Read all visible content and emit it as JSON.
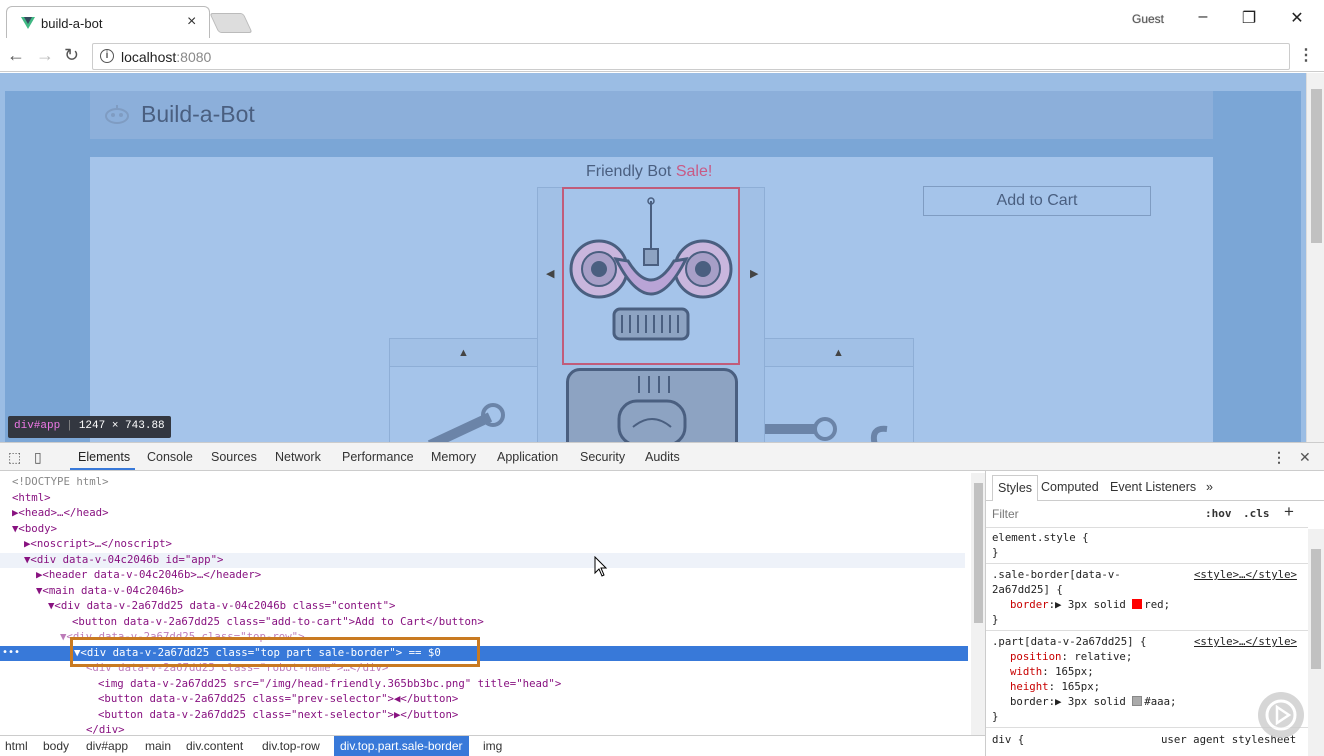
{
  "browser": {
    "tab_title": "build-a-bot",
    "tab_close": "×",
    "profile": "Guest",
    "url_host": "localhost",
    "url_port": ":8080",
    "info_icon": "i",
    "menu": "⋮"
  },
  "page": {
    "brand": "Build-a-Bot",
    "sale_title": "Friendly Bot ",
    "sale_word": "Sale!",
    "add_to_cart": "Add to Cart",
    "prev": "◀",
    "next": "▶",
    "up": "▲"
  },
  "tooltip": {
    "tag": "div#app",
    "size": "1247 × 743.88"
  },
  "devtools": {
    "tabs": [
      "Elements",
      "Console",
      "Sources",
      "Network",
      "Performance",
      "Memory",
      "Application",
      "Security",
      "Audits"
    ],
    "dom_lines": [
      "<!DOCTYPE html>",
      "<html>",
      "▶<head>…</head>",
      "▼<body>",
      "▶<noscript>…</noscript>",
      "▼<div data-v-04c2046b id=\"app\">",
      "▶<header data-v-04c2046b>…</header>",
      "▼<main data-v-04c2046b>",
      "▼<div data-v-2a67dd25 data-v-04c2046b class=\"content\">",
      "<button data-v-2a67dd25 class=\"add-to-cart\">Add to Cart</button>",
      "▼<div data-v-2a67dd25 class=\"top-row\">",
      "▼<div data-v-2a67dd25 class=\"top part sale-border\"> == $0",
      "<div data-v-2a67dd25 class=\"robot-name\">…</div>",
      "<img data-v-2a67dd25 src=\"/img/head-friendly.365bb3bc.png\" title=\"head\">",
      "<button data-v-2a67dd25 class=\"prev-selector\">◀</button>",
      "<button data-v-2a67dd25 class=\"next-selector\">▶</button>",
      "</div>"
    ],
    "breadcrumbs": [
      "html",
      "body",
      "div#app",
      "main",
      "div.content",
      "div.top-row",
      "div.top.part.sale-border",
      "img"
    ],
    "styles_tabs": [
      "Styles",
      "Computed",
      "Event Listeners",
      "»"
    ],
    "filter_placeholder": "Filter",
    "hov": ":hov",
    "cls": ".cls",
    "add": "+",
    "rules": {
      "element_style": "element.style {",
      "close": "}",
      "sale_sel_1": ".sale-border[data-v-",
      "sale_sel_2": "2a67dd25] {",
      "style_src": "<style>…</style>",
      "border_prop": "border",
      "sale_border_val": "3px solid ",
      "sale_border_color": "red;",
      "part_sel": ".part[data-v-2a67dd25] {",
      "position_prop": "position",
      "position_val": "relative;",
      "width_prop": "width",
      "width_val": "165px;",
      "height_prop": "height",
      "height_val": "165px;",
      "part_border_val": "3px solid ",
      "part_border_color": "#aaa;",
      "div_sel": "div {",
      "ua": "user agent stylesheet"
    },
    "colors": {
      "red": "#ff0000",
      "gray": "#aaaaaa",
      "accent": "#3879d9"
    }
  }
}
